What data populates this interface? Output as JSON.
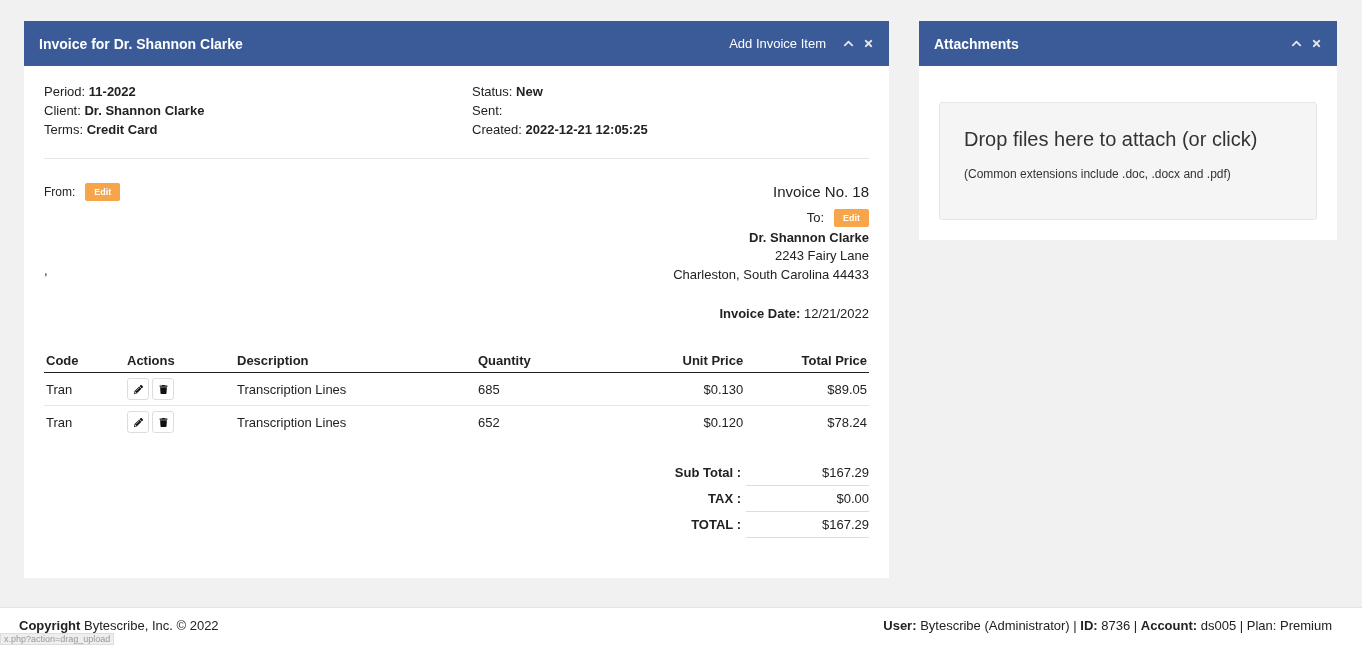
{
  "invoice_panel": {
    "title": "Invoice for Dr. Shannon Clarke",
    "action": "Add Invoice Item",
    "meta_left": [
      "Period: **11-2022**",
      "Client: **Dr. Shannon Clarke**",
      "Terms: **Credit Card**"
    ],
    "meta_right": [
      "Status: **New**",
      "Sent:",
      "Created: **2022-12-21 12:05:25**"
    ],
    "from": {
      "label": "From:",
      "button": "Edit",
      "address": ","
    },
    "invoice_number": "Invoice No. 18",
    "to": {
      "label": "To:",
      "button": "Edit",
      "name": "Dr. Shannon Clarke",
      "lines": [
        "2243 Fairy Lane",
        "Charleston, South Carolina 44433"
      ]
    },
    "invoice_date": "**Invoice Date:** 12/21/2022",
    "table": {
      "columns": [
        "Code",
        "Actions",
        "Description",
        "Quantity",
        "Unit Price",
        "Total Price"
      ],
      "rows": [
        {
          "code": "Tran",
          "description": "Transcription Lines",
          "quantity": "685",
          "unit_price": "$0.130",
          "total_price": "$89.05"
        },
        {
          "code": "Tran",
          "description": "Transcription Lines",
          "quantity": "652",
          "unit_price": "$0.120",
          "total_price": "$78.24"
        }
      ]
    },
    "totals": [
      {
        "label": "Sub Total :",
        "value": "$167.29"
      },
      {
        "label": "TAX :",
        "value": "$0.00"
      },
      {
        "label": "TOTAL :",
        "value": "$167.29"
      }
    ]
  },
  "attachments_panel": {
    "title": "Attachments",
    "drop_title": "Drop files here to attach (or click)",
    "drop_hint": "(Common extensions include .doc, .docx and .pdf)"
  },
  "footer": {
    "left": "**Copyright** Bytescribe, Inc. © 2022",
    "right": "**User:** Bytescribe (Administrator) | **ID:** 8736 | **Account:** ds005 | Plan: Premium"
  },
  "status_url": "x.php?action=drag_upload"
}
